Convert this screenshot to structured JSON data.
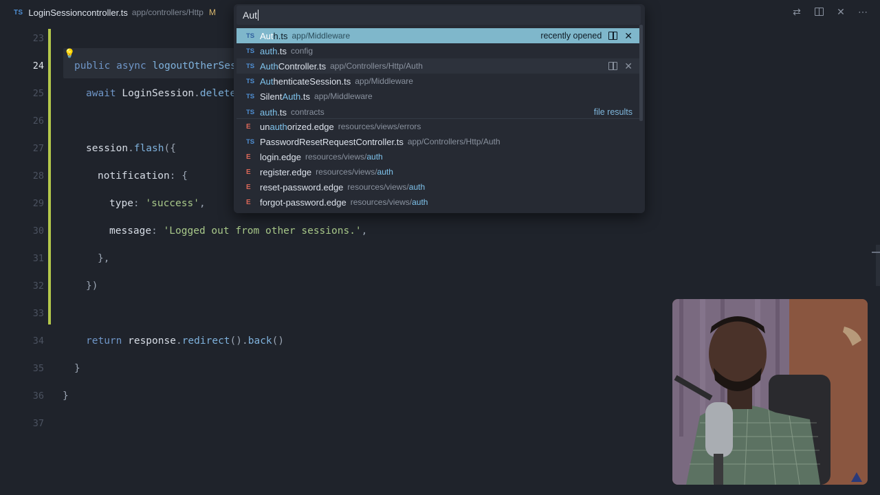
{
  "tab": {
    "badge": "TS",
    "name": "LoginSessioncontroller.ts",
    "path": "app/controllers/Http",
    "status": "M"
  },
  "quick_open": {
    "query": "Aut",
    "items": [
      {
        "icon": "TS",
        "pre": "",
        "match": "Aut",
        "post": "h.ts",
        "path": "app/Middleware",
        "right": "recently opened",
        "selected": true
      },
      {
        "icon": "TS",
        "pre": "",
        "match": "auth",
        "post": ".ts",
        "path": "config"
      },
      {
        "icon": "TS",
        "pre": "",
        "match": "Auth",
        "post": "Controller.ts",
        "path": "app/Controllers/Http/Auth",
        "hover": true
      },
      {
        "icon": "TS",
        "pre": "",
        "match": "Aut",
        "post": "henticateSession.ts",
        "path": "app/Middleware"
      },
      {
        "icon": "TS",
        "pre": "Silent",
        "match": "Auth",
        "post": ".ts",
        "path": "app/Middleware"
      },
      {
        "icon": "TS",
        "pre": "",
        "match": "auth",
        "post": ".ts",
        "path": "contracts",
        "right": "file results"
      },
      {
        "icon": "E",
        "pre": "un",
        "match": "auth",
        "post": "orized.edge",
        "path": "resources/views/errors"
      },
      {
        "icon": "TS",
        "pre": "PasswordResetRequestController.ts",
        "match": "",
        "post": "",
        "path": "app/Controllers/Http/Auth"
      },
      {
        "icon": "E",
        "pre": "login.edge",
        "match": "",
        "post": "",
        "path": "resources/views/",
        "path_match": "auth"
      },
      {
        "icon": "E",
        "pre": "register.edge",
        "match": "",
        "post": "",
        "path": "resources/views/",
        "path_match": "auth"
      },
      {
        "icon": "E",
        "pre": "reset-password.edge",
        "match": "",
        "post": "",
        "path": "resources/views/",
        "path_match": "auth"
      },
      {
        "icon": "E",
        "pre": "forgot-password.edge",
        "match": "",
        "post": "",
        "path": "resources/views/",
        "path_match": "auth"
      }
    ]
  },
  "editor": {
    "active_line": "24",
    "lines": [
      {
        "n": "23",
        "code": []
      },
      {
        "n": "24",
        "code": [
          [
            "kw",
            "public async "
          ],
          [
            "fn",
            "logoutOtherSess"
          ]
        ]
      },
      {
        "n": "25",
        "code": [
          [
            "kw",
            "await "
          ],
          [
            "id",
            "LoginSession"
          ],
          [
            "punc",
            "."
          ],
          [
            "fn",
            "deleteQ"
          ]
        ]
      },
      {
        "n": "26",
        "code": []
      },
      {
        "n": "27",
        "code": [
          [
            "id",
            "session"
          ],
          [
            "punc",
            "."
          ],
          [
            "fn",
            "flash"
          ],
          [
            "punc",
            "({"
          ]
        ]
      },
      {
        "n": "28",
        "code": [
          [
            "id",
            "notification"
          ],
          [
            "punc",
            ": {"
          ]
        ]
      },
      {
        "n": "29",
        "code": [
          [
            "id",
            "type"
          ],
          [
            "punc",
            ": "
          ],
          [
            "str",
            "'success'"
          ],
          [
            "punc",
            ","
          ]
        ]
      },
      {
        "n": "30",
        "code": [
          [
            "id",
            "message"
          ],
          [
            "punc",
            ": "
          ],
          [
            "str",
            "'Logged out from other sessions.'"
          ],
          [
            "punc",
            ","
          ]
        ]
      },
      {
        "n": "31",
        "code": [
          [
            "punc",
            "},"
          ]
        ]
      },
      {
        "n": "32",
        "code": [
          [
            "punc",
            "})"
          ]
        ]
      },
      {
        "n": "33",
        "code": []
      },
      {
        "n": "34",
        "code": [
          [
            "kw",
            "return "
          ],
          [
            "id",
            "response"
          ],
          [
            "punc",
            "."
          ],
          [
            "fn",
            "redirect"
          ],
          [
            "punc",
            "()."
          ],
          [
            "fn",
            "back"
          ],
          [
            "punc",
            "()"
          ]
        ]
      },
      {
        "n": "35",
        "code": [
          [
            "punc",
            "}"
          ]
        ]
      },
      {
        "n": "36",
        "code": [
          [
            "punc",
            "}"
          ]
        ]
      },
      {
        "n": "37",
        "code": []
      }
    ]
  },
  "colors": {
    "selection": "#7fb7cb",
    "match": "#7fc3ec",
    "diff": "#b4c84b"
  }
}
